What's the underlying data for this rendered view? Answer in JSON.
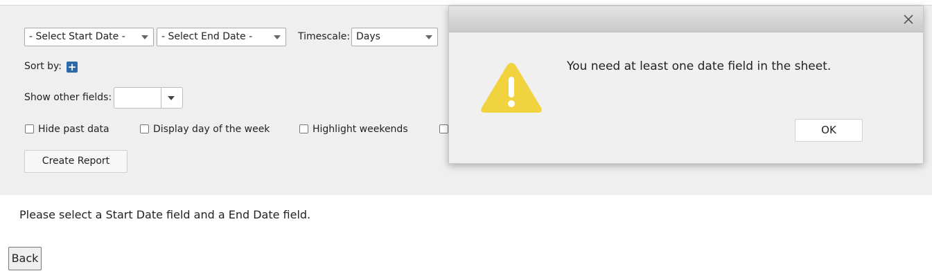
{
  "filters": {
    "start_date": "- Select Start Date -",
    "end_date": "- Select End Date -",
    "timescale_label": "Timescale:",
    "timescale_value": "Days",
    "sort_by_label": "Sort by:",
    "sort_add_icon": "plus-icon",
    "show_other_fields_label": "Show other fields:",
    "show_other_fields_value": ""
  },
  "options": [
    {
      "label": "Hide past data",
      "checked": false
    },
    {
      "label": "Display day of the week",
      "checked": false
    },
    {
      "label": "Highlight weekends",
      "checked": false
    }
  ],
  "create_report_label": "Create Report",
  "message": "Please select a Start Date field and a End Date field.",
  "back_label": "Back",
  "dialog": {
    "message": "You need at least one date field in the sheet.",
    "ok_label": "OK",
    "icon": "warning-icon",
    "icon_color": "#f0d33e"
  }
}
